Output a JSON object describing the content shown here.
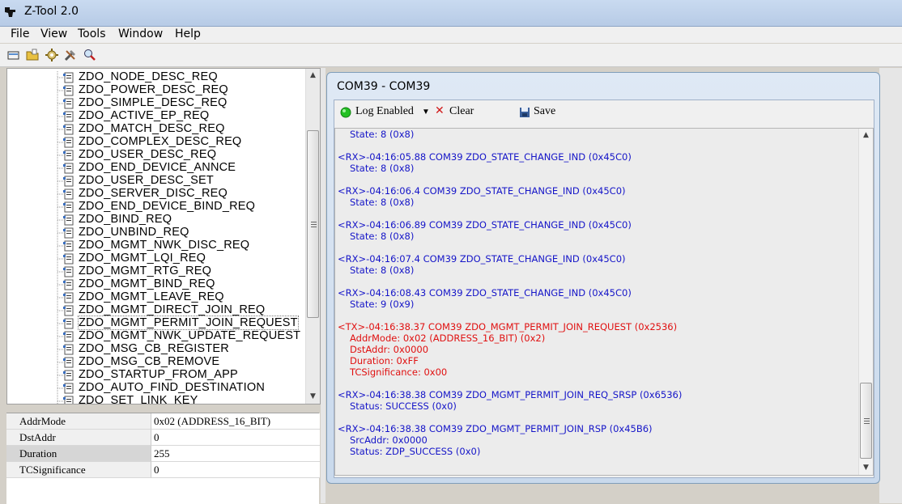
{
  "window": {
    "title": "Z-Tool 2.0"
  },
  "menu": [
    "File",
    "View",
    "Tools",
    "Window",
    "Help"
  ],
  "toolbar_icons": [
    "open-icon",
    "folder-icon",
    "settings-icon",
    "tools-icon",
    "search-icon"
  ],
  "tree": {
    "items": [
      "ZDO_NODE_DESC_REQ",
      "ZDO_POWER_DESC_REQ",
      "ZDO_SIMPLE_DESC_REQ",
      "ZDO_ACTIVE_EP_REQ",
      "ZDO_MATCH_DESC_REQ",
      "ZDO_COMPLEX_DESC_REQ",
      "ZDO_USER_DESC_REQ",
      "ZDO_END_DEVICE_ANNCE",
      "ZDO_USER_DESC_SET",
      "ZDO_SERVER_DISC_REQ",
      "ZDO_END_DEVICE_BIND_REQ",
      "ZDO_BIND_REQ",
      "ZDO_UNBIND_REQ",
      "ZDO_MGMT_NWK_DISC_REQ",
      "ZDO_MGMT_LQI_REQ",
      "ZDO_MGMT_RTG_REQ",
      "ZDO_MGMT_BIND_REQ",
      "ZDO_MGMT_LEAVE_REQ",
      "ZDO_MGMT_DIRECT_JOIN_REQ",
      "ZDO_MGMT_PERMIT_JOIN_REQUEST",
      "ZDO_MGMT_NWK_UPDATE_REQUEST",
      "ZDO_MSG_CB_REGISTER",
      "ZDO_MSG_CB_REMOVE",
      "ZDO_STARTUP_FROM_APP",
      "ZDO_AUTO_FIND_DESTINATION",
      "ZDO_SET_LINK_KEY"
    ],
    "selected_index": 19
  },
  "properties": [
    {
      "name": "AddrMode",
      "value": "0x02 (ADDRESS_16_BIT)"
    },
    {
      "name": "DstAddr",
      "value": "0"
    },
    {
      "name": "Duration",
      "value": "255"
    },
    {
      "name": "TCSignificance",
      "value": "0"
    }
  ],
  "com_window": {
    "title": "COM39 - COM39",
    "log_enabled_label": "Log Enabled",
    "clear_label": "Clear",
    "save_label": "Save"
  },
  "log": [
    {
      "type": "rx",
      "indent": true,
      "text": "State: 8 (0x8)"
    },
    {
      "type": "rx",
      "indent": false,
      "text": "<RX>-04:16:05.88 COM39 ZDO_STATE_CHANGE_IND (0x45C0)"
    },
    {
      "type": "rx",
      "indent": true,
      "text": "State: 8 (0x8)"
    },
    {
      "type": "rx",
      "indent": false,
      "text": "<RX>-04:16:06.4 COM39 ZDO_STATE_CHANGE_IND (0x45C0)"
    },
    {
      "type": "rx",
      "indent": true,
      "text": "State: 8 (0x8)"
    },
    {
      "type": "rx",
      "indent": false,
      "text": "<RX>-04:16:06.89 COM39 ZDO_STATE_CHANGE_IND (0x45C0)"
    },
    {
      "type": "rx",
      "indent": true,
      "text": "State: 8 (0x8)"
    },
    {
      "type": "rx",
      "indent": false,
      "text": "<RX>-04:16:07.4 COM39 ZDO_STATE_CHANGE_IND (0x45C0)"
    },
    {
      "type": "rx",
      "indent": true,
      "text": "State: 8 (0x8)"
    },
    {
      "type": "rx",
      "indent": false,
      "text": "<RX>-04:16:08.43 COM39 ZDO_STATE_CHANGE_IND (0x45C0)"
    },
    {
      "type": "rx",
      "indent": true,
      "text": "State: 9 (0x9)"
    },
    {
      "type": "tx",
      "indent": false,
      "text": "<TX>-04:16:38.37 COM39 ZDO_MGMT_PERMIT_JOIN_REQUEST (0x2536)"
    },
    {
      "type": "tx",
      "indent": true,
      "text": "AddrMode: 0x02 (ADDRESS_16_BIT) (0x2)"
    },
    {
      "type": "tx",
      "indent": true,
      "text": "DstAddr: 0x0000"
    },
    {
      "type": "tx",
      "indent": true,
      "text": "Duration: 0xFF"
    },
    {
      "type": "tx",
      "indent": true,
      "text": "TCSignificance: 0x00"
    },
    {
      "type": "rx",
      "indent": false,
      "text": "<RX>-04:16:38.38 COM39 ZDO_MGMT_PERMIT_JOIN_REQ_SRSP (0x6536)"
    },
    {
      "type": "rx",
      "indent": true,
      "text": "Status: SUCCESS (0x0)"
    },
    {
      "type": "rx",
      "indent": false,
      "text": "<RX>-04:16:38.38 COM39 ZDO_MGMT_PERMIT_JOIN_RSP (0x45B6)"
    },
    {
      "type": "rx",
      "indent": true,
      "text": "SrcAddr: 0x0000"
    },
    {
      "type": "rx",
      "indent": true,
      "text": "Status: ZDP_SUCCESS (0x0)"
    }
  ],
  "colors": {
    "rx": "#1515c8",
    "tx": "#e01010",
    "log_on": "#22c022"
  }
}
